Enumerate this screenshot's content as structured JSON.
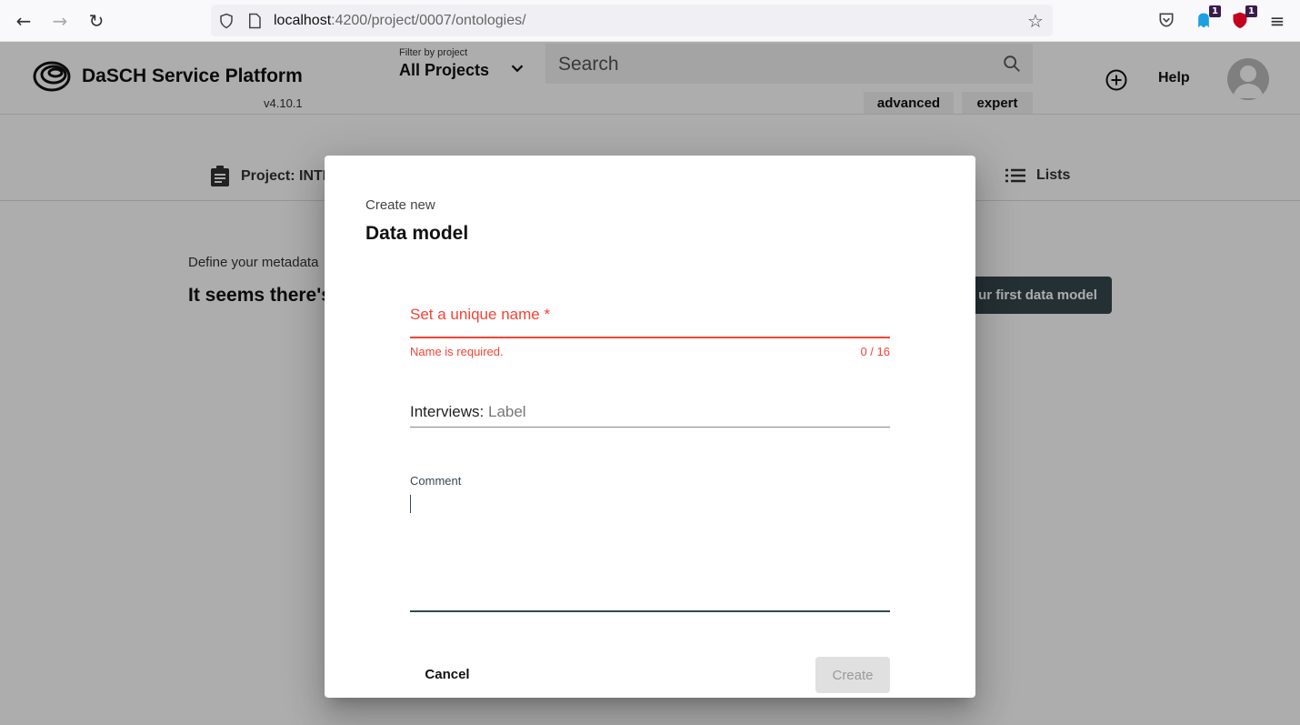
{
  "browser": {
    "url_host": "localhost",
    "url_path": ":4200/project/0007/ontologies/",
    "ext_badge_1": "1",
    "ext_badge_2": "1"
  },
  "header": {
    "brand": "DaSCH Service Platform",
    "version": "v4.10.1",
    "filter_label": "Filter by project",
    "filter_value": "All Projects",
    "search_placeholder": "Search",
    "advanced_label": "advanced",
    "expert_label": "expert",
    "help_label": "Help"
  },
  "subnav": {
    "project_tab": "Project: INTE",
    "lists_tab": "Lists"
  },
  "page": {
    "subtitle": "Define your metadata",
    "title": "It seems there's",
    "create_first_label": "ur first data model"
  },
  "dialog": {
    "subtitle": "Create new",
    "title": "Data model",
    "name_label": "Set a unique name *",
    "name_error": "Name is required.",
    "name_counter": "0 / 16",
    "label_prefix": "Interviews: ",
    "label_placeholder": "Label",
    "comment_label": "Comment",
    "cancel_label": "Cancel",
    "create_label": "Create"
  },
  "colors": {
    "error": "#f44336",
    "primary": "#37474f"
  }
}
